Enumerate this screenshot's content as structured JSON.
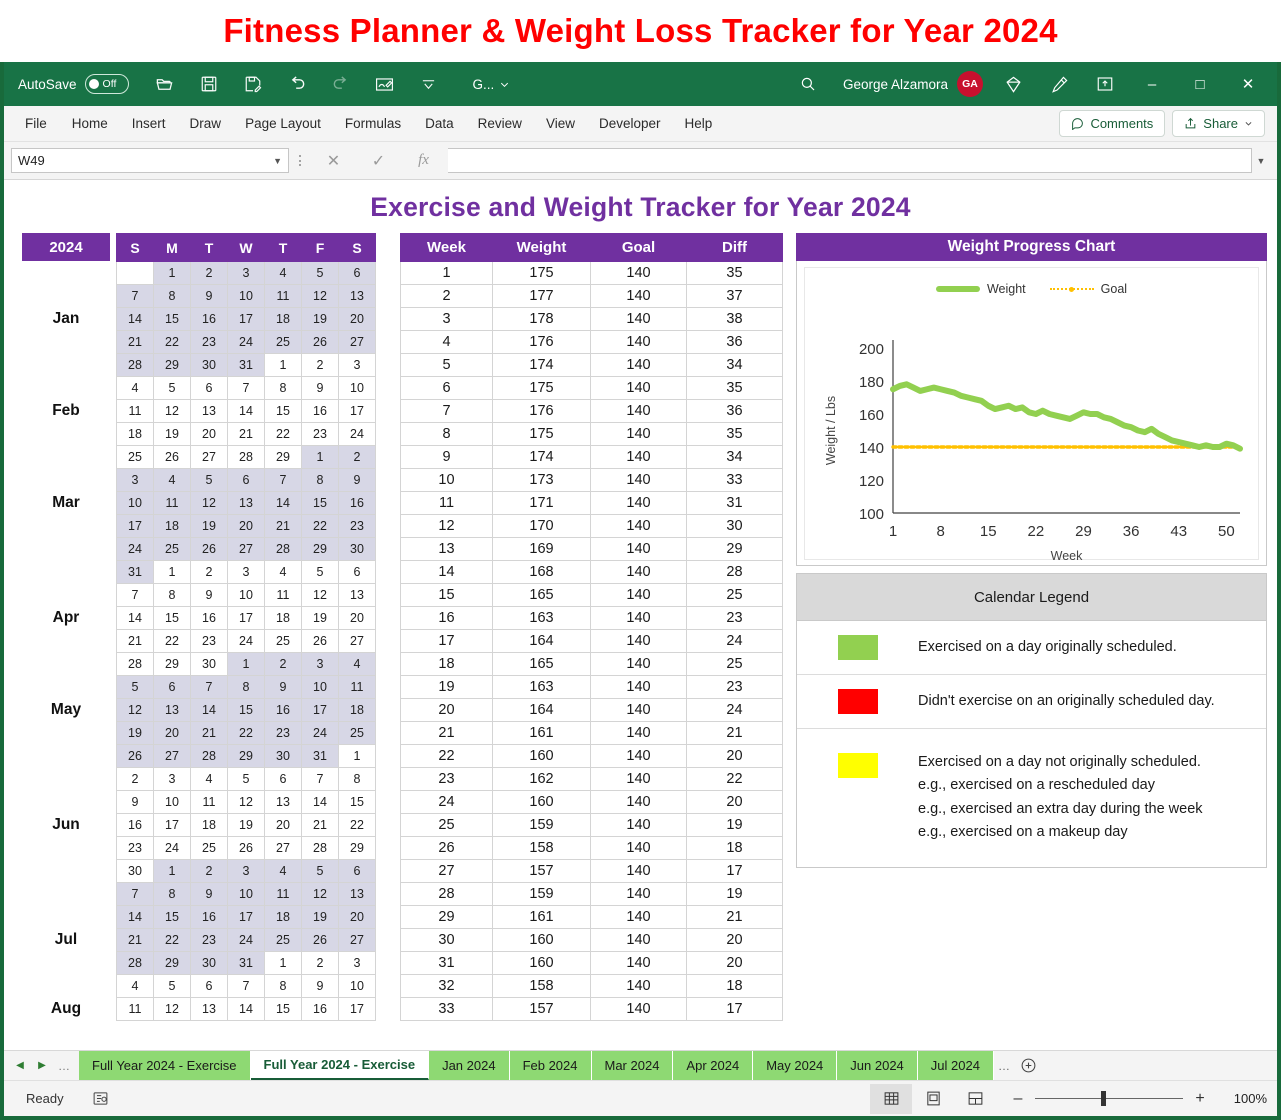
{
  "banner": {
    "title": "Fitness Planner & Weight Loss Tracker for Year 2024"
  },
  "titlebar": {
    "autosave_label": "AutoSave",
    "autosave_state": "Off",
    "filename": "G...",
    "user_name": "George Alzamora",
    "user_initials": "GA",
    "icons": [
      "open-folder-icon",
      "save-icon",
      "save-as-icon",
      "undo-icon",
      "redo-icon",
      "touch-draw-icon",
      "customize-qat-icon"
    ],
    "window_minimize": "–",
    "window_maximize": "□",
    "window_close": "✕"
  },
  "ribbon": {
    "tabs": [
      "File",
      "Home",
      "Insert",
      "Draw",
      "Page Layout",
      "Formulas",
      "Data",
      "Review",
      "View",
      "Developer",
      "Help"
    ],
    "comments_label": "Comments",
    "share_label": "Share"
  },
  "formula_bar": {
    "name_box": "W49",
    "cancel": "✕",
    "enter": "✓",
    "fx": "fx",
    "value": "",
    "placeholder": ""
  },
  "sheet": {
    "title": "Exercise and Weight Tracker for Year 2024",
    "calendar": {
      "year_label": "2024",
      "day_headers": [
        "S",
        "M",
        "T",
        "W",
        "T",
        "F",
        "S"
      ],
      "months": [
        {
          "name": "Jan",
          "shaded": true,
          "label_row": 2,
          "weeks": [
            [
              "",
              "1",
              "2",
              "3",
              "4",
              "5",
              "6"
            ],
            [
              "7",
              "8",
              "9",
              "10",
              "11",
              "12",
              "13"
            ],
            [
              "14",
              "15",
              "16",
              "17",
              "18",
              "19",
              "20"
            ],
            [
              "21",
              "22",
              "23",
              "24",
              "25",
              "26",
              "27"
            ],
            [
              "28",
              "29",
              "30",
              "31",
              "",
              "",
              ""
            ]
          ],
          "trailing": [
            "1",
            "2",
            "3"
          ]
        },
        {
          "name": "Feb",
          "shaded": false,
          "label_row": 1,
          "weeks": [
            [
              "4",
              "5",
              "6",
              "7",
              "8",
              "9",
              "10"
            ],
            [
              "11",
              "12",
              "13",
              "14",
              "15",
              "16",
              "17"
            ],
            [
              "18",
              "19",
              "20",
              "21",
              "22",
              "23",
              "24"
            ],
            [
              "25",
              "26",
              "27",
              "28",
              "29",
              "",
              ""
            ]
          ],
          "trailing": [
            "1",
            "2"
          ]
        },
        {
          "name": "Mar",
          "shaded": true,
          "label_row": 1,
          "weeks": [
            [
              "3",
              "4",
              "5",
              "6",
              "7",
              "8",
              "9"
            ],
            [
              "10",
              "11",
              "12",
              "13",
              "14",
              "15",
              "16"
            ],
            [
              "17",
              "18",
              "19",
              "20",
              "21",
              "22",
              "23"
            ],
            [
              "24",
              "25",
              "26",
              "27",
              "28",
              "29",
              "30"
            ],
            [
              "31",
              "",
              "",
              "",
              "",
              "",
              ""
            ]
          ],
          "trailing": [
            "1",
            "2",
            "3",
            "4",
            "5",
            "6"
          ]
        },
        {
          "name": "Apr",
          "shaded": false,
          "label_row": 1,
          "weeks": [
            [
              "7",
              "8",
              "9",
              "10",
              "11",
              "12",
              "13"
            ],
            [
              "14",
              "15",
              "16",
              "17",
              "18",
              "19",
              "20"
            ],
            [
              "21",
              "22",
              "23",
              "24",
              "25",
              "26",
              "27"
            ],
            [
              "28",
              "29",
              "30",
              "",
              "",
              "",
              ""
            ]
          ],
          "trailing": [
            "1",
            "2",
            "3",
            "4"
          ]
        },
        {
          "name": "May",
          "shaded": true,
          "label_row": 1,
          "weeks": [
            [
              "5",
              "6",
              "7",
              "8",
              "9",
              "10",
              "11"
            ],
            [
              "12",
              "13",
              "14",
              "15",
              "16",
              "17",
              "18"
            ],
            [
              "19",
              "20",
              "21",
              "22",
              "23",
              "24",
              "25"
            ],
            [
              "26",
              "27",
              "28",
              "29",
              "30",
              "31",
              ""
            ]
          ],
          "trailing": [
            "1"
          ]
        },
        {
          "name": "Jun",
          "shaded": false,
          "label_row": 2,
          "weeks": [
            [
              "2",
              "3",
              "4",
              "5",
              "6",
              "7",
              "8"
            ],
            [
              "9",
              "10",
              "11",
              "12",
              "13",
              "14",
              "15"
            ],
            [
              "16",
              "17",
              "18",
              "19",
              "20",
              "21",
              "22"
            ],
            [
              "23",
              "24",
              "25",
              "26",
              "27",
              "28",
              "29"
            ],
            [
              "30",
              "",
              "",
              "",
              "",
              "",
              ""
            ]
          ],
          "trailing": [
            "1",
            "2",
            "3",
            "4",
            "5",
            "6"
          ]
        },
        {
          "name": "Jul",
          "shaded": true,
          "label_row": 2,
          "weeks": [
            [
              "7",
              "8",
              "9",
              "10",
              "11",
              "12",
              "13"
            ],
            [
              "14",
              "15",
              "16",
              "17",
              "18",
              "19",
              "20"
            ],
            [
              "21",
              "22",
              "23",
              "24",
              "25",
              "26",
              "27"
            ],
            [
              "28",
              "29",
              "30",
              "31",
              "",
              "",
              ""
            ]
          ],
          "trailing": [
            "1",
            "2",
            "3"
          ]
        },
        {
          "name": "Aug",
          "shaded": false,
          "label_row": 1,
          "weeks": [
            [
              "4",
              "5",
              "6",
              "7",
              "8",
              "9",
              "10"
            ],
            [
              "11",
              "12",
              "13",
              "14",
              "15",
              "16",
              "17"
            ]
          ],
          "trailing": []
        }
      ]
    },
    "weight_table": {
      "headers": [
        "Week",
        "Weight",
        "Goal",
        "Diff"
      ],
      "rows": [
        [
          1,
          175,
          140,
          35
        ],
        [
          2,
          177,
          140,
          37
        ],
        [
          3,
          178,
          140,
          38
        ],
        [
          4,
          176,
          140,
          36
        ],
        [
          5,
          174,
          140,
          34
        ],
        [
          6,
          175,
          140,
          35
        ],
        [
          7,
          176,
          140,
          36
        ],
        [
          8,
          175,
          140,
          35
        ],
        [
          9,
          174,
          140,
          34
        ],
        [
          10,
          173,
          140,
          33
        ],
        [
          11,
          171,
          140,
          31
        ],
        [
          12,
          170,
          140,
          30
        ],
        [
          13,
          169,
          140,
          29
        ],
        [
          14,
          168,
          140,
          28
        ],
        [
          15,
          165,
          140,
          25
        ],
        [
          16,
          163,
          140,
          23
        ],
        [
          17,
          164,
          140,
          24
        ],
        [
          18,
          165,
          140,
          25
        ],
        [
          19,
          163,
          140,
          23
        ],
        [
          20,
          164,
          140,
          24
        ],
        [
          21,
          161,
          140,
          21
        ],
        [
          22,
          160,
          140,
          20
        ],
        [
          23,
          162,
          140,
          22
        ],
        [
          24,
          160,
          140,
          20
        ],
        [
          25,
          159,
          140,
          19
        ],
        [
          26,
          158,
          140,
          18
        ],
        [
          27,
          157,
          140,
          17
        ],
        [
          28,
          159,
          140,
          19
        ],
        [
          29,
          161,
          140,
          21
        ],
        [
          30,
          160,
          140,
          20
        ],
        [
          31,
          160,
          140,
          20
        ],
        [
          32,
          158,
          140,
          18
        ],
        [
          33,
          157,
          140,
          17
        ]
      ]
    },
    "chart_panel": {
      "header": "Weight Progress Chart"
    },
    "legend_panel": {
      "header": "Calendar Legend",
      "rows": [
        {
          "color": "#92D050",
          "text": "Exercised on a day originally scheduled.",
          "lines": [
            "Exercised on a day originally scheduled."
          ]
        },
        {
          "color": "#FF0000",
          "text": "Didn't exercise on an originally scheduled day.",
          "lines": [
            "Didn't exercise on an originally scheduled day."
          ]
        },
        {
          "color": "#FFFF00",
          "text": "Exercised on a day not originally scheduled.",
          "lines": [
            "Exercised on a day not originally scheduled.",
            "e.g., exercised on a rescheduled day",
            "e.g., exercised an extra day during the week",
            "e.g., exercised on a makeup day"
          ]
        }
      ]
    }
  },
  "chart_data": {
    "type": "line",
    "title": "Weight Progress Chart",
    "xlabel": "Week",
    "ylabel": "Weight / Lbs",
    "ylim": [
      100,
      200
    ],
    "ytick_labels": [
      "200",
      "180",
      "160",
      "140",
      "120",
      "100"
    ],
    "xtick_labels": [
      "1",
      "8",
      "15",
      "22",
      "29",
      "36",
      "43",
      "50"
    ],
    "grid": false,
    "legend_position": "top-center",
    "series": [
      {
        "name": "Weight",
        "color": "#92D050",
        "x": [
          1,
          2,
          3,
          4,
          5,
          6,
          7,
          8,
          9,
          10,
          11,
          12,
          13,
          14,
          15,
          16,
          17,
          18,
          19,
          20,
          21,
          22,
          23,
          24,
          25,
          26,
          27,
          28,
          29,
          30,
          31,
          32,
          33,
          34,
          35,
          36,
          37,
          38,
          39,
          40,
          41,
          42,
          43,
          44,
          45,
          46,
          47,
          48,
          49,
          50,
          51,
          52
        ],
        "values": [
          175,
          177,
          178,
          176,
          174,
          175,
          176,
          175,
          174,
          173,
          171,
          170,
          169,
          168,
          165,
          163,
          164,
          165,
          163,
          164,
          161,
          160,
          162,
          160,
          159,
          158,
          157,
          159,
          161,
          160,
          160,
          158,
          157,
          155,
          153,
          152,
          150,
          149,
          151,
          148,
          146,
          144,
          143,
          142,
          141,
          140,
          141,
          140,
          140,
          142,
          141,
          139
        ]
      },
      {
        "name": "Goal",
        "color": "#FFC000",
        "x": [
          1,
          52
        ],
        "values": [
          140,
          140
        ]
      }
    ]
  },
  "sheet_tabs": {
    "nav": {
      "prev": "◀",
      "next": "▶",
      "more": "…"
    },
    "tabs": [
      {
        "label": "Full Year 2024 - Exercise",
        "active": false
      },
      {
        "label": "Full Year 2024 - Exercise",
        "active": true
      },
      {
        "label": "Jan 2024",
        "active": false
      },
      {
        "label": "Feb 2024",
        "active": false
      },
      {
        "label": "Mar 2024",
        "active": false
      },
      {
        "label": "Apr 2024",
        "active": false
      },
      {
        "label": "May 2024",
        "active": false
      },
      {
        "label": "Jun 2024",
        "active": false
      },
      {
        "label": "Jul 2024",
        "active": false
      }
    ],
    "overflow": "…",
    "add_sheet": "+"
  },
  "status_bar": {
    "status": "Ready",
    "accessibility_icon": "accessibility-checker-icon",
    "views": [
      "normal-view-icon",
      "page-layout-view-icon",
      "page-break-view-icon"
    ],
    "zoom_minus": "–",
    "zoom_plus": "+",
    "zoom_percent": "100%"
  },
  "colors": {
    "banner_red": "#FF0000",
    "excel_green": "#187346",
    "purple": "#7030A0",
    "tab_green": "#8ED973",
    "calendar_shade": "#D7D7E6",
    "legend_green": "#92D050",
    "legend_red": "#FF0000",
    "legend_yellow": "#FFFF00",
    "goal_gold": "#FFC000"
  }
}
